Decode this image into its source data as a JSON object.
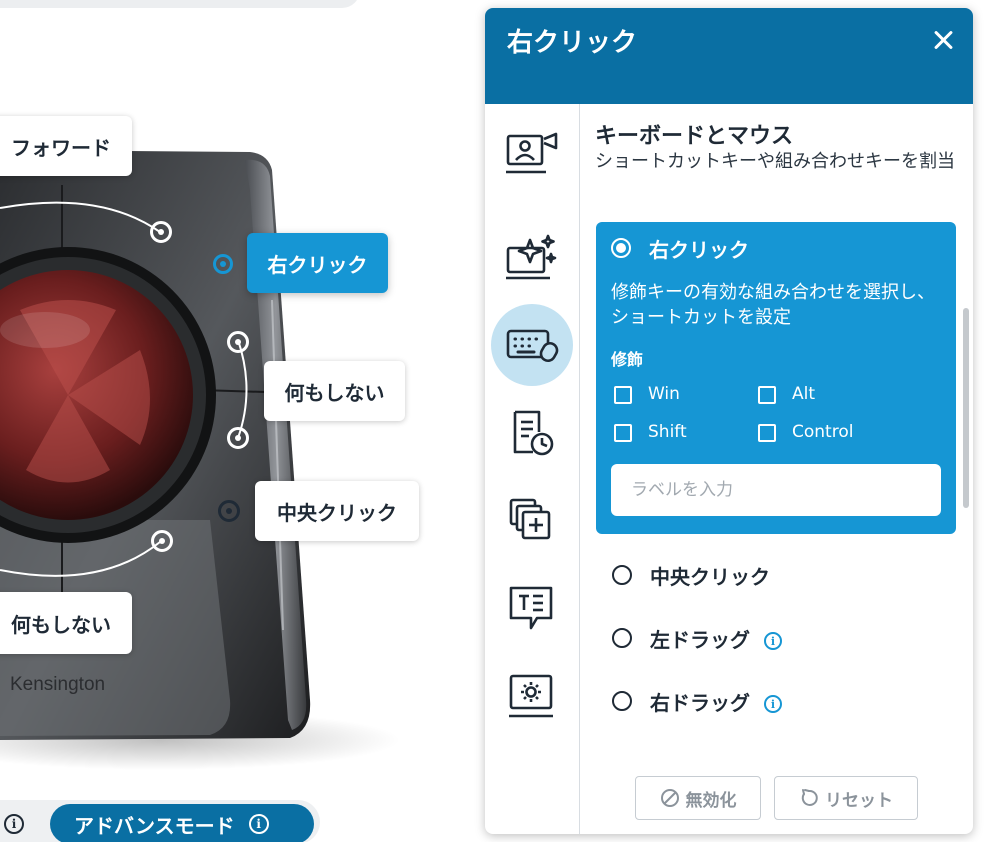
{
  "device": {
    "brand_logo": "Kensington",
    "callouts": {
      "forward": "フォワード",
      "right_click": "右クリック",
      "do_nothing_right": "何もしない",
      "middle_click": "中央クリック",
      "do_nothing_bottom": "何もしない"
    }
  },
  "footer_left": {
    "advanced_mode_label": "アドバンスモード",
    "info_glyph": "i"
  },
  "panel": {
    "title": "右クリック",
    "rail_icons": [
      "presentation-icon",
      "magic-sparkle-icon",
      "keyboard-mouse-icon",
      "document-clock-icon",
      "multi-window-add-icon",
      "text-bubble-icon",
      "settings-screen-icon"
    ],
    "section_title": "キーボードとマウス",
    "section_desc": "ショートカットキーや組み合わせキーを割当",
    "options": {
      "right_click": {
        "label": "右クリック",
        "desc": "修飾キーの有効な組み合わせを選択し、ショートカットを設定",
        "modifier_label": "修飾",
        "modifiers": [
          "Win",
          "Alt",
          "Shift",
          "Control"
        ],
        "input_placeholder": "ラベルを入力"
      },
      "middle_click": "中央クリック",
      "left_drag": "左ドラッグ",
      "right_drag": "右ドラッグ"
    },
    "buttons": {
      "disable": "無効化",
      "reset": "リセット"
    },
    "colors": {
      "header": "#0a6fa3",
      "accent": "#1696d4",
      "selected_rail": "#c3e2f2"
    }
  }
}
